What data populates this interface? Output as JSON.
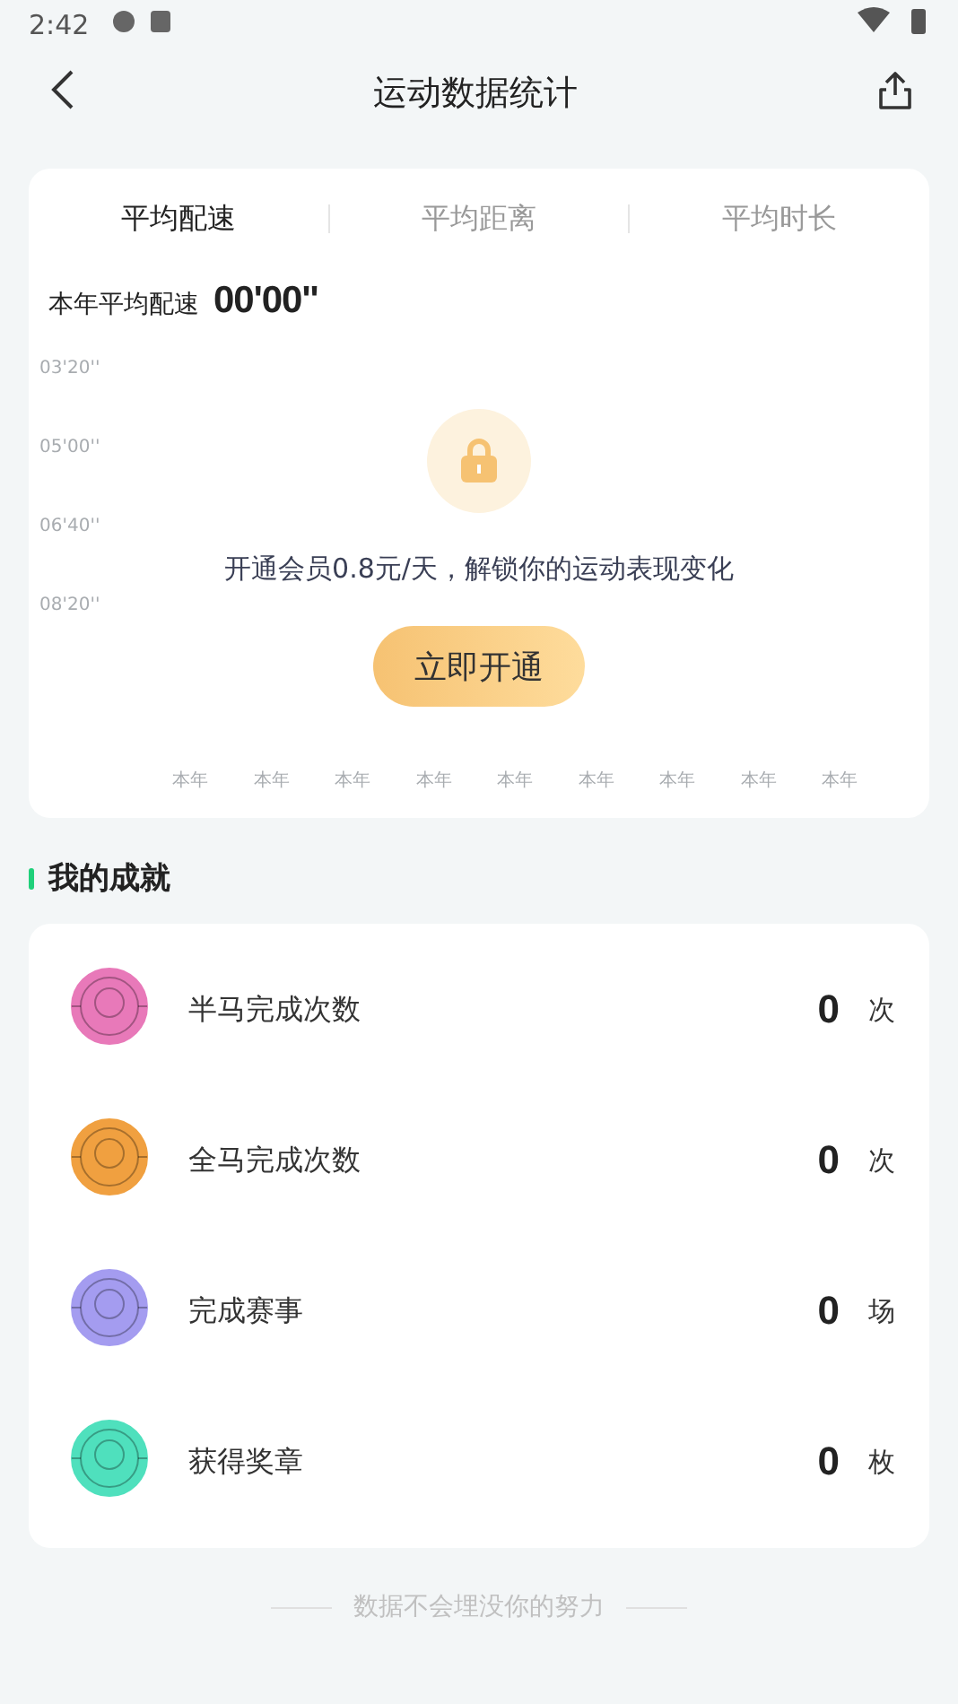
{
  "status_bar": {
    "time": "2:42"
  },
  "header": {
    "title": "运动数据统计"
  },
  "tabs": [
    {
      "label": "平均配速",
      "selected": true
    },
    {
      "label": "平均距离",
      "selected": false
    },
    {
      "label": "平均时长",
      "selected": false
    }
  ],
  "summary": {
    "label": "本年平均配速",
    "value": "00'00''"
  },
  "locked_chart": {
    "y_labels": [
      "03'20''",
      "05'00''",
      "06'40''",
      "08'20''"
    ],
    "x_labels": [
      "本年",
      "本年",
      "本年",
      "本年",
      "本年",
      "本年",
      "本年",
      "本年",
      "本年"
    ],
    "message": "开通会员0.8元/天，解锁你的运动表现变化",
    "button": "立即开通"
  },
  "achievements": {
    "title": "我的成就",
    "items": [
      {
        "label": "半马完成次数",
        "value": "0",
        "unit": "次",
        "color": "#e879b9"
      },
      {
        "label": "全马完成次数",
        "value": "0",
        "unit": "次",
        "color": "#f0a040"
      },
      {
        "label": "完成赛事",
        "value": "0",
        "unit": "场",
        "color": "#a49cf0"
      },
      {
        "label": "获得奖章",
        "value": "0",
        "unit": "枚",
        "color": "#4fe0bd"
      }
    ]
  },
  "footer": "数据不会埋没你的努力"
}
